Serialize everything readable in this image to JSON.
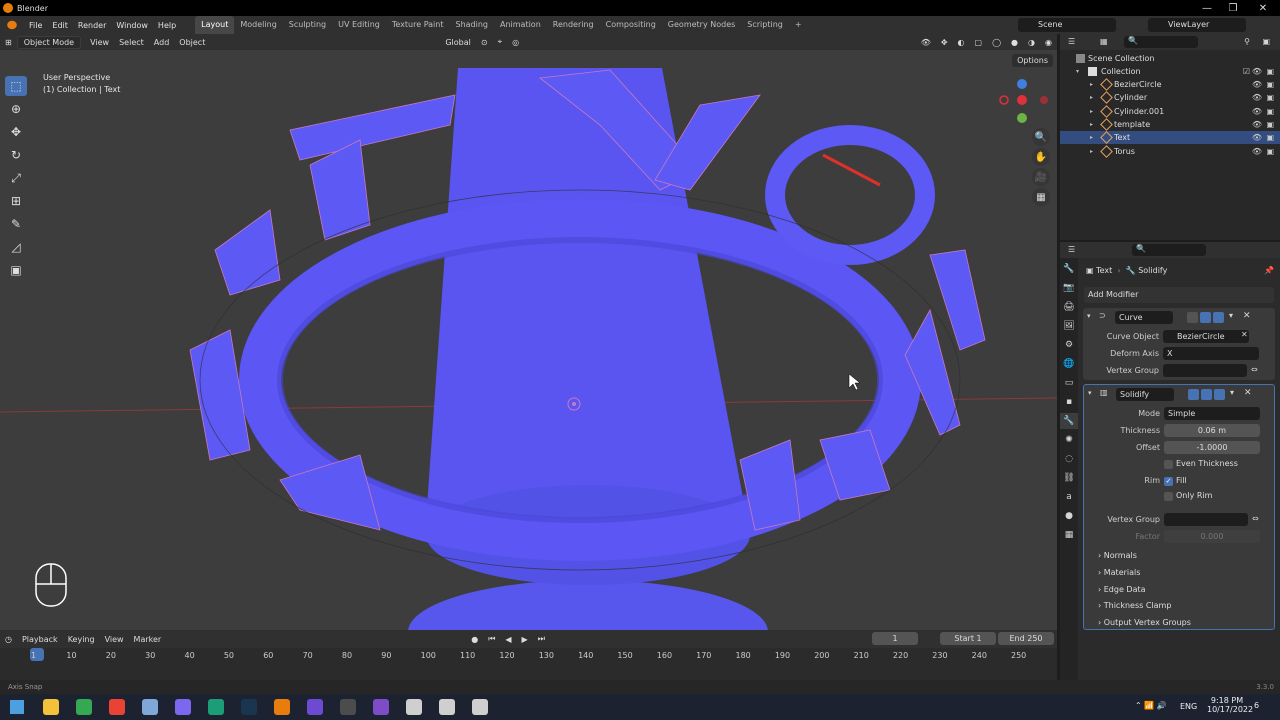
{
  "window": {
    "title": "Blender",
    "minimize": "—",
    "maximize": "❐",
    "close": "✕"
  },
  "menu": {
    "items": [
      "File",
      "Edit",
      "Render",
      "Window",
      "Help"
    ]
  },
  "workspaces": [
    "Layout",
    "Modeling",
    "Sculpting",
    "UV Editing",
    "Texture Paint",
    "Shading",
    "Animation",
    "Rendering",
    "Compositing",
    "Geometry Nodes",
    "Scripting"
  ],
  "workspace_add": "+",
  "scene": {
    "name": "Scene",
    "view_layer": "ViewLayer"
  },
  "viewport_header": {
    "mode": "Object Mode",
    "menus": [
      "View",
      "Select",
      "Add",
      "Object"
    ],
    "orientation": "Global"
  },
  "viewport": {
    "view_name": "User Perspective",
    "collection_info": "(1) Collection | Text",
    "options": "Options"
  },
  "timeline_header": {
    "menus": [
      "Playback",
      "Keying",
      "View",
      "Marker"
    ],
    "current_frame": "1",
    "start_label": "Start",
    "start_value": "1",
    "end_label": "End",
    "end_value": "250"
  },
  "timeline_ticks": [
    "1",
    "10",
    "20",
    "30",
    "40",
    "50",
    "60",
    "70",
    "80",
    "90",
    "100",
    "110",
    "120",
    "130",
    "140",
    "150",
    "160",
    "170",
    "180",
    "190",
    "200",
    "210",
    "220",
    "230",
    "240",
    "250"
  ],
  "statusbar": {
    "hint": "Axis Snap",
    "version": "3.3.0"
  },
  "outliner": {
    "root": "Scene Collection",
    "collection": "Collection",
    "objects": [
      {
        "name": "BezierCircle",
        "color": "#e8a35c",
        "selected": false
      },
      {
        "name": "Cylinder",
        "color": "#e8a35c",
        "selected": false
      },
      {
        "name": "Cylinder.001",
        "color": "#e8a35c",
        "selected": false
      },
      {
        "name": "template",
        "color": "#e8a35c",
        "selected": false
      },
      {
        "name": "Text",
        "color": "#e8a35c",
        "selected": true
      },
      {
        "name": "Torus",
        "color": "#e8a35c",
        "selected": false
      }
    ]
  },
  "properties": {
    "breadcrumb_object": "Text",
    "breadcrumb_modifier": "Solidify",
    "add_modifier": "Add Modifier",
    "curve_modifier": {
      "name": "Curve",
      "curve_object_label": "Curve Object",
      "curve_object": "BezierCircle",
      "deform_axis_label": "Deform Axis",
      "deform_axis": "X",
      "vertex_group_label": "Vertex Group"
    },
    "solidify_modifier": {
      "name": "Solidify",
      "mode_label": "Mode",
      "mode": "Simple",
      "thickness_label": "Thickness",
      "thickness": "0.06 m",
      "offset_label": "Offset",
      "offset": "-1.0000",
      "even_thickness": "Even Thickness",
      "rim_label": "Rim",
      "fill": "Fill",
      "only_rim": "Only Rim",
      "vertex_group_label": "Vertex Group",
      "factor_label": "Factor",
      "factor": "0.000",
      "subpanels": [
        "Normals",
        "Materials",
        "Edge Data",
        "Thickness Clamp",
        "Output Vertex Groups"
      ]
    }
  },
  "taskbar": {
    "language": "ENG",
    "time": "9:18 PM",
    "date": "10/17/2022",
    "notifications": "6",
    "icons": [
      "#f3c13a",
      "#34a853",
      "#ea4335",
      "#7fa7d8",
      "#7b68ee",
      "#1b9e77",
      "#1a3550",
      "#e87d0d",
      "#6c4bd1",
      "#4c4c4c",
      "#7f4cc7",
      "#cfcfcf",
      "#cfcfcf",
      "#cfcfcf"
    ]
  },
  "colors": {
    "accent": "#4772b3",
    "scene_object": "#5a55f0",
    "selection": "#334d80"
  }
}
